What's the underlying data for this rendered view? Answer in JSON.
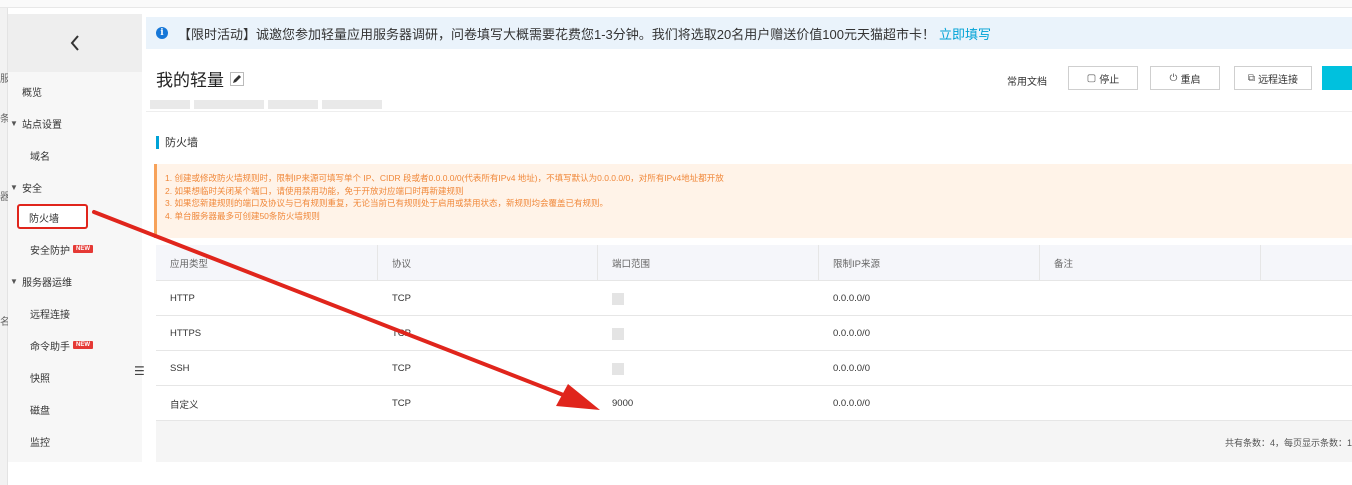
{
  "sidebar": {
    "edge_glyphs": [
      "服",
      "条",
      "器",
      "名"
    ],
    "items": [
      {
        "label": "概览",
        "kind": "top"
      },
      {
        "label": "站点设置",
        "kind": "group"
      },
      {
        "label": "域名",
        "kind": "sub"
      },
      {
        "label": "安全",
        "kind": "group"
      },
      {
        "label": "防火墙",
        "kind": "sub",
        "active": true
      },
      {
        "label": "安全防护",
        "kind": "sub",
        "badge": "NEW"
      },
      {
        "label": "服务器运维",
        "kind": "group"
      },
      {
        "label": "远程连接",
        "kind": "sub"
      },
      {
        "label": "命令助手",
        "kind": "sub",
        "badge": "NEW"
      },
      {
        "label": "快照",
        "kind": "sub"
      },
      {
        "label": "磁盘",
        "kind": "sub"
      },
      {
        "label": "监控",
        "kind": "sub"
      }
    ]
  },
  "notice": {
    "text": "【限时活动】诚邀您参加轻量应用服务器调研，问卷填写大概需要花费您1-3分钟。我们将选取20名用户赠送价值100元天猫超市卡！",
    "link": "立即填写"
  },
  "header": {
    "title": "我的轻量",
    "docs": "常用文档",
    "stop": "停止",
    "restart": "重启",
    "remote": "远程连接"
  },
  "section": {
    "title": "防火墙"
  },
  "warning": {
    "lines": [
      "1. 创建或修改防火墙规则时，限制IP来源可填写单个 IP、CIDR 段或者0.0.0.0/0(代表所有IPv4 地址)，不填写默认为0.0.0.0/0，对所有IPv4地址都开放",
      "2. 如果想临时关闭某个端口，请使用禁用功能，免于开放对应端口时再新建规则",
      "3. 如果您新建规则的端口及协议与已有规则重复，无论当前已有规则处于启用或禁用状态，新规则均会覆盖已有规则。",
      "4. 单台服务器最多可创建50条防火墙规则"
    ]
  },
  "table": {
    "headers": [
      "应用类型",
      "协议",
      "端口范围",
      "限制IP来源",
      "备注",
      ""
    ],
    "rows": [
      {
        "app": "HTTP",
        "protocol": "TCP",
        "port": "",
        "source": "0.0.0.0/0",
        "note": ""
      },
      {
        "app": "HTTPS",
        "protocol": "TCP",
        "port": "",
        "source": "0.0.0.0/0",
        "note": ""
      },
      {
        "app": "SSH",
        "protocol": "TCP",
        "port": "",
        "source": "0.0.0.0/0",
        "note": ""
      },
      {
        "app": "自定义",
        "protocol": "TCP",
        "port": "9000",
        "source": "0.0.0.0/0",
        "note": ""
      }
    ],
    "pager": "共有条数：4，每页显示条数：1"
  },
  "colors": {
    "accent": "#00a2d6",
    "annotation": "#e0251c",
    "warning_text": "#f0883a",
    "badge": "#e53935"
  }
}
